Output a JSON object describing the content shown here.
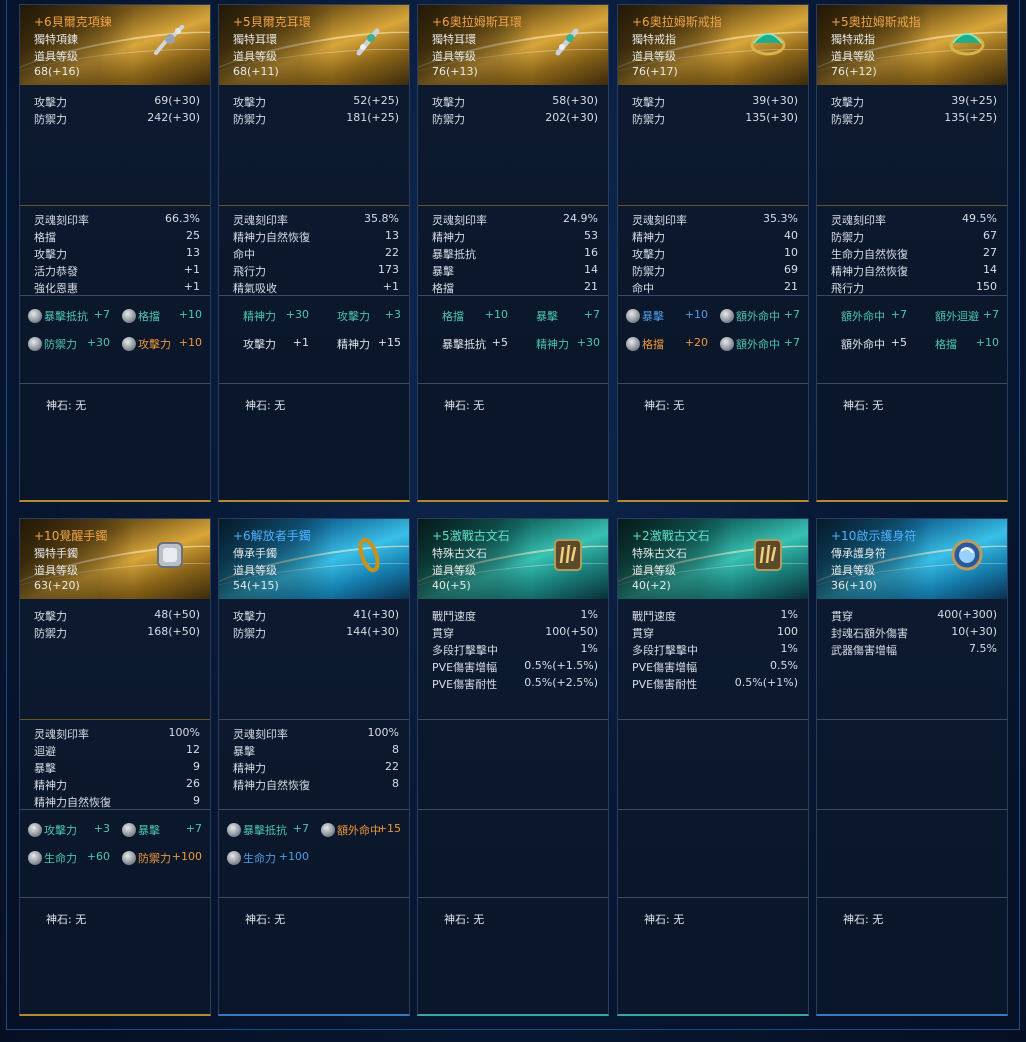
{
  "cards": [
    {
      "theme": "gold",
      "title": "+6貝爾克項鍊",
      "type": "獨特項鍊",
      "level_label": "道具等级",
      "level": "68(+16)",
      "icon": "necklace-icon",
      "base": [
        [
          "攻擊力",
          "69(+30)"
        ],
        [
          "防禦力",
          "242(+30)"
        ]
      ],
      "soul": [
        [
          "灵魂刻印率",
          "66.3%"
        ],
        [
          "格擋",
          "25"
        ],
        [
          "攻擊力",
          "13"
        ],
        [
          "活力恭發",
          "+1"
        ],
        [
          "強化恩惠",
          "+1"
        ]
      ],
      "gems": [
        {
          "icon": true,
          "label": "暴擊抵抗",
          "value": "+7",
          "color": "teal"
        },
        {
          "icon": true,
          "label": "格擋",
          "value": "+10",
          "color": "teal"
        },
        {
          "icon": true,
          "label": "防禦力",
          "value": "+30",
          "color": "teal"
        },
        {
          "icon": true,
          "label": "攻擊力",
          "value": "+10",
          "color": "orange"
        }
      ],
      "shenshi": "神石: 无"
    },
    {
      "theme": "gold",
      "title": "+5貝爾克耳環",
      "type": "獨特耳環",
      "level_label": "道具等级",
      "level": "68(+11)",
      "icon": "earring-icon",
      "base": [
        [
          "攻擊力",
          "52(+25)"
        ],
        [
          "防禦力",
          "181(+25)"
        ]
      ],
      "soul": [
        [
          "灵魂刻印率",
          "35.8%"
        ],
        [
          "精神力自然恢復",
          "13"
        ],
        [
          "命中",
          "22"
        ],
        [
          "飛行力",
          "173"
        ],
        [
          "精氣吸收",
          "+1"
        ]
      ],
      "gems": [
        {
          "icon": false,
          "label": "精神力",
          "value": "+30",
          "color": "teal"
        },
        {
          "icon": false,
          "label": "攻擊力",
          "value": "+3",
          "color": "teal"
        },
        {
          "icon": false,
          "label": "攻擊力",
          "value": "+1",
          "color": "white"
        },
        {
          "icon": false,
          "label": "精神力",
          "value": "+15",
          "color": "white"
        }
      ],
      "shenshi": "神石: 无"
    },
    {
      "theme": "gold",
      "title": "+6奧拉姆斯耳環",
      "type": "獨特耳環",
      "level_label": "道具等级",
      "level": "76(+13)",
      "icon": "earring-icon",
      "base": [
        [
          "攻擊力",
          "58(+30)"
        ],
        [
          "防禦力",
          "202(+30)"
        ]
      ],
      "soul": [
        [
          "灵魂刻印率",
          "24.9%"
        ],
        [
          "精神力",
          "53"
        ],
        [
          "暴擊抵抗",
          "16"
        ],
        [
          "暴擊",
          "14"
        ],
        [
          "格擋",
          "21"
        ]
      ],
      "gems": [
        {
          "icon": false,
          "label": "格擋",
          "value": "+10",
          "color": "teal"
        },
        {
          "icon": false,
          "label": "暴擊",
          "value": "+7",
          "color": "teal"
        },
        {
          "icon": false,
          "label": "暴擊抵抗",
          "value": "+5",
          "color": "white"
        },
        {
          "icon": false,
          "label": "精神力",
          "value": "+30",
          "color": "teal"
        }
      ],
      "shenshi": "神石: 无"
    },
    {
      "theme": "gold",
      "title": "+6奧拉姆斯戒指",
      "type": "獨特戒指",
      "level_label": "道具等级",
      "level": "76(+17)",
      "icon": "ring-icon",
      "base": [
        [
          "攻擊力",
          "39(+30)"
        ],
        [
          "防禦力",
          "135(+30)"
        ]
      ],
      "soul": [
        [
          "灵魂刻印率",
          "35.3%"
        ],
        [
          "精神力",
          "40"
        ],
        [
          "攻擊力",
          "10"
        ],
        [
          "防禦力",
          "69"
        ],
        [
          "命中",
          "21"
        ]
      ],
      "gems": [
        {
          "icon": true,
          "label": "暴擊",
          "value": "+10",
          "color": "blue"
        },
        {
          "icon": true,
          "label": "額外命中",
          "value": "+7",
          "color": "teal"
        },
        {
          "icon": true,
          "label": "格擋",
          "value": "+20",
          "color": "orange"
        },
        {
          "icon": true,
          "label": "額外命中",
          "value": "+7",
          "color": "teal"
        }
      ],
      "shenshi": "神石: 无"
    },
    {
      "theme": "gold",
      "title": "+5奧拉姆斯戒指",
      "type": "獨特戒指",
      "level_label": "道具等级",
      "level": "76(+12)",
      "icon": "ring-icon",
      "base": [
        [
          "攻擊力",
          "39(+25)"
        ],
        [
          "防禦力",
          "135(+25)"
        ]
      ],
      "soul": [
        [
          "灵魂刻印率",
          "49.5%"
        ],
        [
          "防禦力",
          "67"
        ],
        [
          "生命力自然恢復",
          "27"
        ],
        [
          "精神力自然恢復",
          "14"
        ],
        [
          "飛行力",
          "150"
        ]
      ],
      "gems": [
        {
          "icon": false,
          "label": "額外命中",
          "value": "+7",
          "color": "teal"
        },
        {
          "icon": false,
          "label": "額外迴避",
          "value": "+7",
          "color": "teal"
        },
        {
          "icon": false,
          "label": "額外命中",
          "value": "+5",
          "color": "white"
        },
        {
          "icon": false,
          "label": "格擋",
          "value": "+10",
          "color": "teal"
        }
      ],
      "shenshi": "神石: 无"
    },
    {
      "theme": "gold",
      "title": "+10覺醒手鐲",
      "type": "獨特手鐲",
      "level_label": "道具等级",
      "level": "63(+20)",
      "icon": "bracelet-icon",
      "base": [
        [
          "攻擊力",
          "48(+50)"
        ],
        [
          "防禦力",
          "168(+50)"
        ]
      ],
      "soul": [
        [
          "灵魂刻印率",
          "100%"
        ],
        [
          "迴避",
          "12"
        ],
        [
          "暴擊",
          "9"
        ],
        [
          "精神力",
          "26"
        ],
        [
          "精神力自然恢復",
          "9"
        ]
      ],
      "gems": [
        {
          "icon": true,
          "label": "攻擊力",
          "value": "+3",
          "color": "teal"
        },
        {
          "icon": true,
          "label": "暴擊",
          "value": "+7",
          "color": "teal"
        },
        {
          "icon": true,
          "label": "生命力",
          "value": "+60",
          "color": "teal"
        },
        {
          "icon": true,
          "label": "防禦力",
          "value": "+100",
          "color": "orange"
        }
      ],
      "shenshi": "神石: 无"
    },
    {
      "theme": "blue",
      "title": "+6解放者手鐲",
      "type": "傳承手鐲",
      "level_label": "道具等级",
      "level": "54(+15)",
      "icon": "bracelet-icon",
      "base": [
        [
          "攻擊力",
          "41(+30)"
        ],
        [
          "防禦力",
          "144(+30)"
        ]
      ],
      "soul": [
        [
          "灵魂刻印率",
          "100%"
        ],
        [
          "暴擊",
          "8"
        ],
        [
          "精神力",
          "22"
        ],
        [
          "精神力自然恢復",
          "8"
        ]
      ],
      "gems": [
        {
          "icon": true,
          "label": "暴擊抵抗",
          "value": "+7",
          "color": "teal"
        },
        {
          "icon": true,
          "label": "額外命中",
          "value": "+15",
          "color": "orange"
        },
        {
          "icon": true,
          "label": "生命力",
          "value": "+100",
          "color": "blue"
        }
      ],
      "shenshi": "神石: 无"
    },
    {
      "theme": "teal",
      "title": "+5激戰古文石",
      "type": "特殊古文石",
      "level_label": "道具等级",
      "level": "40(+5)",
      "icon": "rune-stone-icon",
      "base": [
        [
          "戰鬥速度",
          "1%"
        ],
        [
          "貫穿",
          "100(+50)"
        ],
        [
          "多段打擊擊中",
          "1%"
        ],
        [
          "PVE傷害增幅",
          "0.5%(+1.5%)"
        ],
        [
          "PVE傷害耐性",
          "0.5%(+2.5%)"
        ]
      ],
      "soul": [],
      "gems": [],
      "shenshi": "神石: 无"
    },
    {
      "theme": "teal",
      "title": "+2激戰古文石",
      "type": "特殊古文石",
      "level_label": "道具等级",
      "level": "40(+2)",
      "icon": "rune-stone-icon",
      "base": [
        [
          "戰鬥速度",
          "1%"
        ],
        [
          "貫穿",
          "100"
        ],
        [
          "多段打擊擊中",
          "1%"
        ],
        [
          "PVE傷害增幅",
          "0.5%"
        ],
        [
          "PVE傷害耐性",
          "0.5%(+1%)"
        ]
      ],
      "soul": [],
      "gems": [],
      "shenshi": "神石: 无"
    },
    {
      "theme": "blue",
      "title": "+10啟示護身符",
      "type": "傳承護身符",
      "level_label": "道具等级",
      "level": "36(+10)",
      "icon": "amulet-icon",
      "base": [
        [
          "貫穿",
          "400(+300)"
        ],
        [
          "封魂石額外傷害",
          "10(+30)"
        ],
        [
          "武器傷害增幅",
          "7.5%"
        ]
      ],
      "soul": [],
      "gems": [],
      "shenshi": "神石: 无"
    }
  ]
}
